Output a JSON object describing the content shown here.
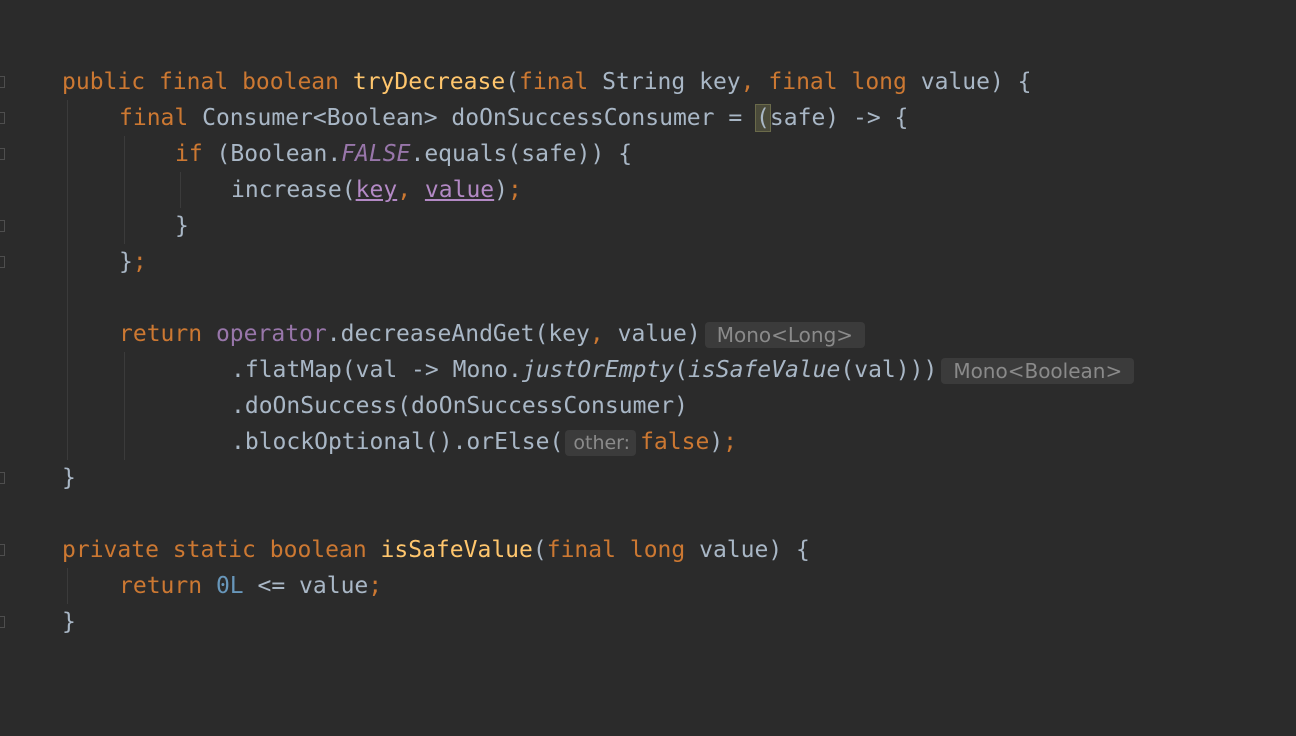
{
  "colors": {
    "background": "#2b2b2b",
    "keyword": "#cc7832",
    "method_declaration": "#ffc66d",
    "static_field": "#9876aa",
    "parameter_usage": "#b389c5",
    "number": "#6897bb",
    "default_text": "#a9b7c6",
    "hint_background": "#3b3b3b",
    "hint_text": "#8a8a8a"
  },
  "icons": [
    "fold-marker-icon"
  ],
  "code": {
    "kw_public": "public",
    "kw_private": "private",
    "kw_static": "static",
    "kw_final": "final",
    "kw_boolean": "boolean",
    "kw_long": "long",
    "kw_if": "if",
    "kw_return": "return",
    "kw_false": "false",
    "method_tryDecrease": "tryDecrease",
    "method_isSafeValue": "isSafeValue",
    "method_increase": "increase",
    "method_equals": "equals",
    "method_decreaseAndGet": "decreaseAndGet",
    "method_flatMap": "flatMap",
    "method_justOrEmpty": "justOrEmpty",
    "method_doOnSuccess": "doOnSuccess",
    "method_blockOptional": "blockOptional",
    "method_orElse": "orElse",
    "type_String": "String",
    "type_Consumer": "Consumer",
    "type_Boolean": "Boolean",
    "type_Mono": "Mono",
    "field_FALSE": "FALSE",
    "field_operator": "operator",
    "var_key": "key",
    "var_value": "value",
    "var_safe": "safe",
    "var_val": "val",
    "var_consumer": "doOnSuccessConsumer",
    "literal_0L": "0L"
  },
  "hints": {
    "mono_long": "Mono<Long>",
    "mono_boolean": "Mono<Boolean>",
    "param_other": "other:"
  }
}
